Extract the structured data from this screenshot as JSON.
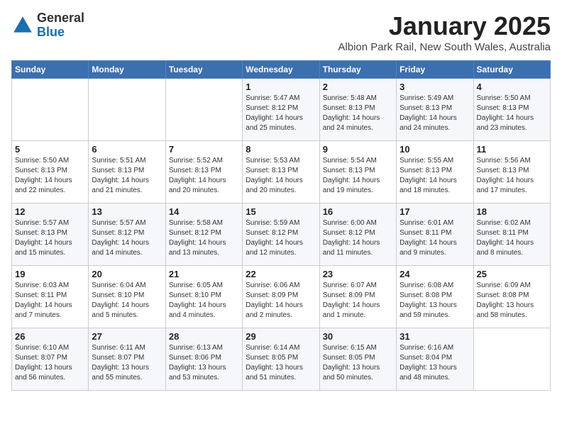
{
  "header": {
    "logo": {
      "general": "General",
      "blue": "Blue"
    },
    "title": "January 2025",
    "location": "Albion Park Rail, New South Wales, Australia"
  },
  "weekdays": [
    "Sunday",
    "Monday",
    "Tuesday",
    "Wednesday",
    "Thursday",
    "Friday",
    "Saturday"
  ],
  "weeks": [
    [
      {
        "day": null,
        "info": null
      },
      {
        "day": null,
        "info": null
      },
      {
        "day": null,
        "info": null
      },
      {
        "day": "1",
        "info": "Sunrise: 5:47 AM\nSunset: 8:12 PM\nDaylight: 14 hours\nand 25 minutes."
      },
      {
        "day": "2",
        "info": "Sunrise: 5:48 AM\nSunset: 8:13 PM\nDaylight: 14 hours\nand 24 minutes."
      },
      {
        "day": "3",
        "info": "Sunrise: 5:49 AM\nSunset: 8:13 PM\nDaylight: 14 hours\nand 24 minutes."
      },
      {
        "day": "4",
        "info": "Sunrise: 5:50 AM\nSunset: 8:13 PM\nDaylight: 14 hours\nand 23 minutes."
      }
    ],
    [
      {
        "day": "5",
        "info": "Sunrise: 5:50 AM\nSunset: 8:13 PM\nDaylight: 14 hours\nand 22 minutes."
      },
      {
        "day": "6",
        "info": "Sunrise: 5:51 AM\nSunset: 8:13 PM\nDaylight: 14 hours\nand 21 minutes."
      },
      {
        "day": "7",
        "info": "Sunrise: 5:52 AM\nSunset: 8:13 PM\nDaylight: 14 hours\nand 20 minutes."
      },
      {
        "day": "8",
        "info": "Sunrise: 5:53 AM\nSunset: 8:13 PM\nDaylight: 14 hours\nand 20 minutes."
      },
      {
        "day": "9",
        "info": "Sunrise: 5:54 AM\nSunset: 8:13 PM\nDaylight: 14 hours\nand 19 minutes."
      },
      {
        "day": "10",
        "info": "Sunrise: 5:55 AM\nSunset: 8:13 PM\nDaylight: 14 hours\nand 18 minutes."
      },
      {
        "day": "11",
        "info": "Sunrise: 5:56 AM\nSunset: 8:13 PM\nDaylight: 14 hours\nand 17 minutes."
      }
    ],
    [
      {
        "day": "12",
        "info": "Sunrise: 5:57 AM\nSunset: 8:13 PM\nDaylight: 14 hours\nand 15 minutes."
      },
      {
        "day": "13",
        "info": "Sunrise: 5:57 AM\nSunset: 8:12 PM\nDaylight: 14 hours\nand 14 minutes."
      },
      {
        "day": "14",
        "info": "Sunrise: 5:58 AM\nSunset: 8:12 PM\nDaylight: 14 hours\nand 13 minutes."
      },
      {
        "day": "15",
        "info": "Sunrise: 5:59 AM\nSunset: 8:12 PM\nDaylight: 14 hours\nand 12 minutes."
      },
      {
        "day": "16",
        "info": "Sunrise: 6:00 AM\nSunset: 8:12 PM\nDaylight: 14 hours\nand 11 minutes."
      },
      {
        "day": "17",
        "info": "Sunrise: 6:01 AM\nSunset: 8:11 PM\nDaylight: 14 hours\nand 9 minutes."
      },
      {
        "day": "18",
        "info": "Sunrise: 6:02 AM\nSunset: 8:11 PM\nDaylight: 14 hours\nand 8 minutes."
      }
    ],
    [
      {
        "day": "19",
        "info": "Sunrise: 6:03 AM\nSunset: 8:11 PM\nDaylight: 14 hours\nand 7 minutes."
      },
      {
        "day": "20",
        "info": "Sunrise: 6:04 AM\nSunset: 8:10 PM\nDaylight: 14 hours\nand 5 minutes."
      },
      {
        "day": "21",
        "info": "Sunrise: 6:05 AM\nSunset: 8:10 PM\nDaylight: 14 hours\nand 4 minutes."
      },
      {
        "day": "22",
        "info": "Sunrise: 6:06 AM\nSunset: 8:09 PM\nDaylight: 14 hours\nand 2 minutes."
      },
      {
        "day": "23",
        "info": "Sunrise: 6:07 AM\nSunset: 8:09 PM\nDaylight: 14 hours\nand 1 minute."
      },
      {
        "day": "24",
        "info": "Sunrise: 6:08 AM\nSunset: 8:08 PM\nDaylight: 13 hours\nand 59 minutes."
      },
      {
        "day": "25",
        "info": "Sunrise: 6:09 AM\nSunset: 8:08 PM\nDaylight: 13 hours\nand 58 minutes."
      }
    ],
    [
      {
        "day": "26",
        "info": "Sunrise: 6:10 AM\nSunset: 8:07 PM\nDaylight: 13 hours\nand 56 minutes."
      },
      {
        "day": "27",
        "info": "Sunrise: 6:11 AM\nSunset: 8:07 PM\nDaylight: 13 hours\nand 55 minutes."
      },
      {
        "day": "28",
        "info": "Sunrise: 6:13 AM\nSunset: 8:06 PM\nDaylight: 13 hours\nand 53 minutes."
      },
      {
        "day": "29",
        "info": "Sunrise: 6:14 AM\nSunset: 8:05 PM\nDaylight: 13 hours\nand 51 minutes."
      },
      {
        "day": "30",
        "info": "Sunrise: 6:15 AM\nSunset: 8:05 PM\nDaylight: 13 hours\nand 50 minutes."
      },
      {
        "day": "31",
        "info": "Sunrise: 6:16 AM\nSunset: 8:04 PM\nDaylight: 13 hours\nand 48 minutes."
      },
      {
        "day": null,
        "info": null
      }
    ]
  ]
}
